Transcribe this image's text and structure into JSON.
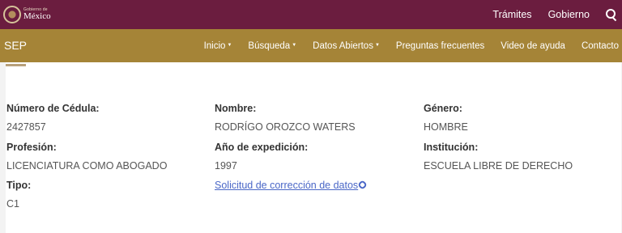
{
  "gov_bar": {
    "logo_small": "Gobierno de",
    "logo_big": "México",
    "links": [
      "Trámites",
      "Gobierno"
    ]
  },
  "nav_bar": {
    "brand": "SEP",
    "items": [
      "Inicio",
      "Búsqueda",
      "Datos Abiertos",
      "Preguntas frecuentes",
      "Video de ayuda",
      "Contacto"
    ]
  },
  "record": {
    "cedula_label": "Número de Cédula:",
    "cedula_value": "2427857",
    "nombre_label": "Nombre:",
    "nombre_value": "RODRÍGO OROZCO WATERS",
    "genero_label": "Género:",
    "genero_value": "HOMBRE",
    "profesion_label": "Profesión:",
    "profesion_value": "LICENCIATURA COMO ABOGADO",
    "anio_label": "Año de expedición:",
    "anio_value": "1997",
    "institucion_label": "Institución:",
    "institucion_value": "ESCUELA LIBRE DE DERECHO",
    "tipo_label": "Tipo:",
    "tipo_value": "C1",
    "correction_link": "Solicitud de corrección de datos"
  },
  "colors": {
    "gov_bar": "#6b1d3f",
    "nav_bar": "#a58437",
    "link": "#4a67c7"
  }
}
